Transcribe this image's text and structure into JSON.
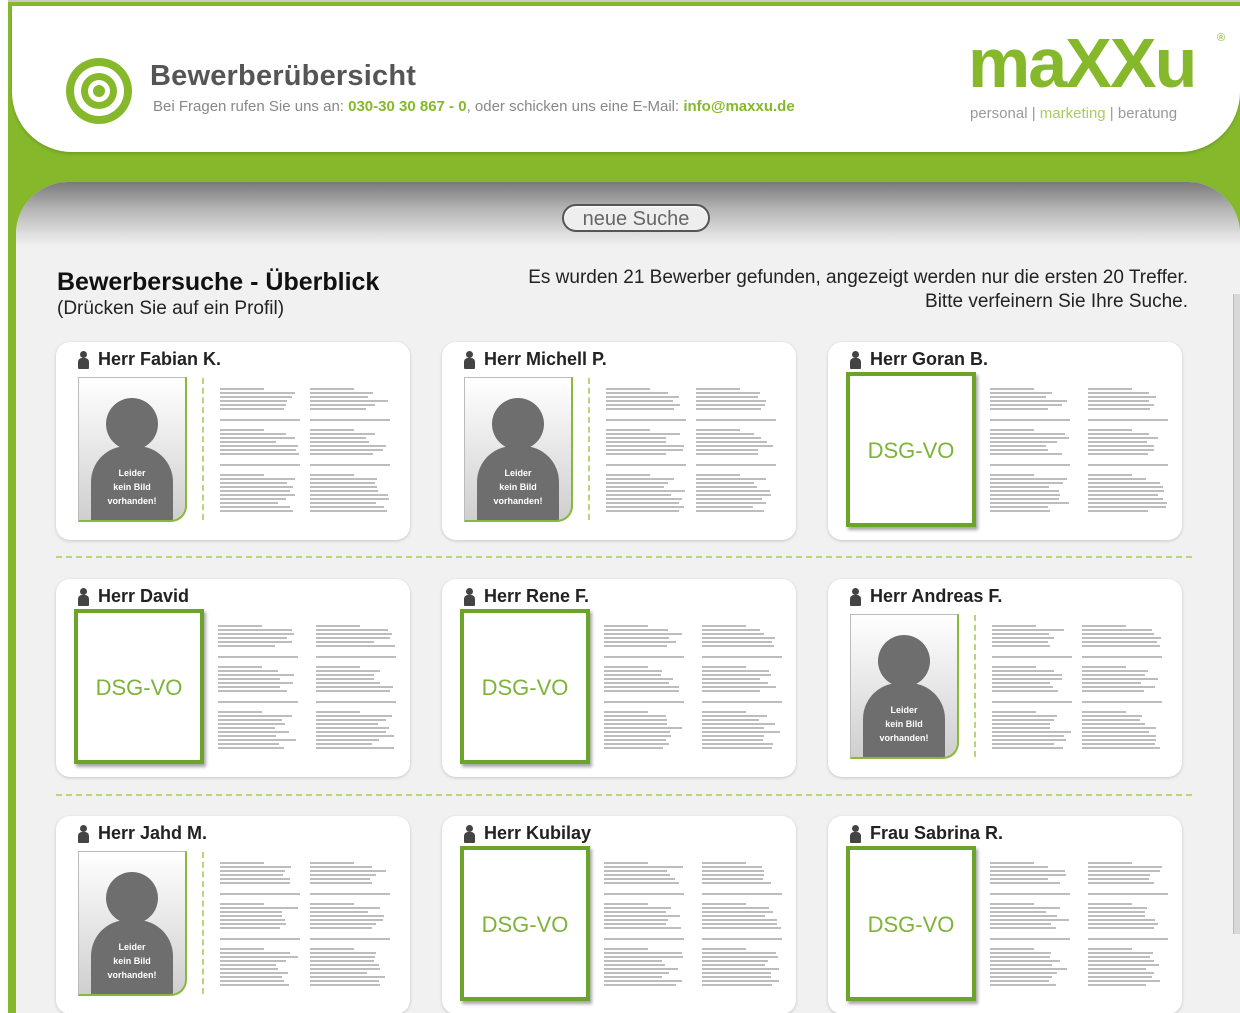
{
  "header": {
    "title": "Bewerberübersicht",
    "contact_prefix": "Bei Fragen rufen Sie uns an: ",
    "phone": "030-30 30 867 - 0",
    "contact_middle": ", oder schicken uns eine E-Mail: ",
    "email": "info@maxxu.de"
  },
  "brand": {
    "name_part1": "ma",
    "name_xx": "XX",
    "name_part2": "u",
    "registered": "®",
    "sub_personal": "personal",
    "sub_sep1": " | ",
    "sub_marketing": "marketing",
    "sub_sep2": " | ",
    "sub_beratung": "beratung"
  },
  "toolbar": {
    "new_search_label": "neue Suche"
  },
  "results": {
    "title": "Bewerbersuche - Überblick",
    "subtitle": "(Drücken Sie auf ein Profil)",
    "info_line1": "Es wurden 21 Bewerber gefunden, angezeigt werden nur die ersten 20 Treffer.",
    "info_line2": "Bitte verfeinern Sie Ihre Suche."
  },
  "placeholder_photo_text": [
    "Leider",
    "kein Bild",
    "vorhanden!"
  ],
  "dsg_label": "DSG-VO",
  "applicants": [
    {
      "name": "Herr Fabian K.",
      "photo": "placeholder"
    },
    {
      "name": "Herr Michell P.",
      "photo": "placeholder"
    },
    {
      "name": "Herr Goran B.",
      "photo": "dsg"
    },
    {
      "name": "Herr David",
      "photo": "dsg"
    },
    {
      "name": "Herr Rene F.",
      "photo": "dsg"
    },
    {
      "name": "Herr Andreas F.",
      "photo": "placeholder"
    },
    {
      "name": "Herr Jahd M.",
      "photo": "placeholder"
    },
    {
      "name": "Herr Kubilay",
      "photo": "dsg"
    },
    {
      "name": "Frau Sabrina R.",
      "photo": "dsg"
    }
  ],
  "colors": {
    "accent": "#85b92b",
    "panel": "#f1f1f1"
  }
}
